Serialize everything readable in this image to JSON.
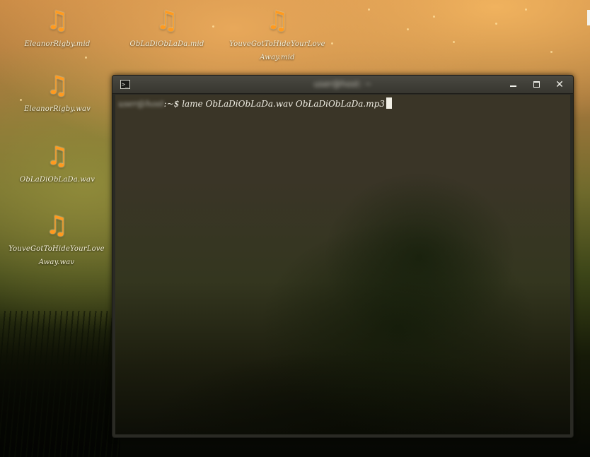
{
  "desktop": {
    "icons": [
      {
        "name": "desktop-icon-eleanorrigby-mid",
        "label": "EleanorRigby.mid",
        "glyph": "♫",
        "icon": "music-file-icon"
      },
      {
        "name": "desktop-icon-obladioblada-mid",
        "label": "ObLaDiObLaDa.mid",
        "glyph": "♫",
        "icon": "music-file-icon"
      },
      {
        "name": "desktop-icon-youvegottohide-mid",
        "label": "YouveGotToHideYourLoveAway.mid",
        "glyph": "♫",
        "icon": "music-file-icon"
      },
      {
        "name": "desktop-icon-eleanorrigby-wav",
        "label": "EleanorRigby.wav",
        "glyph": "♫",
        "icon": "music-file-icon"
      },
      {
        "name": "desktop-icon-obladioblada-wav",
        "label": "ObLaDiObLaDa.wav",
        "glyph": "♫",
        "icon": "music-file-icon"
      },
      {
        "name": "desktop-icon-youvegottohide-wav",
        "label": "YouveGotToHideYourLoveAway.wav",
        "glyph": "♫",
        "icon": "music-file-icon"
      }
    ]
  },
  "terminal": {
    "title": "user@host: ~",
    "icon": "terminal-icon",
    "buttons": {
      "minimize": "minimize-icon",
      "maximize": "maximize-icon",
      "close": "✕"
    },
    "user_host": "user@host",
    "prompt_suffix": ":~$ lame ObLaDiObLaDa.wav ObLaDiObLaDa.mp3"
  }
}
